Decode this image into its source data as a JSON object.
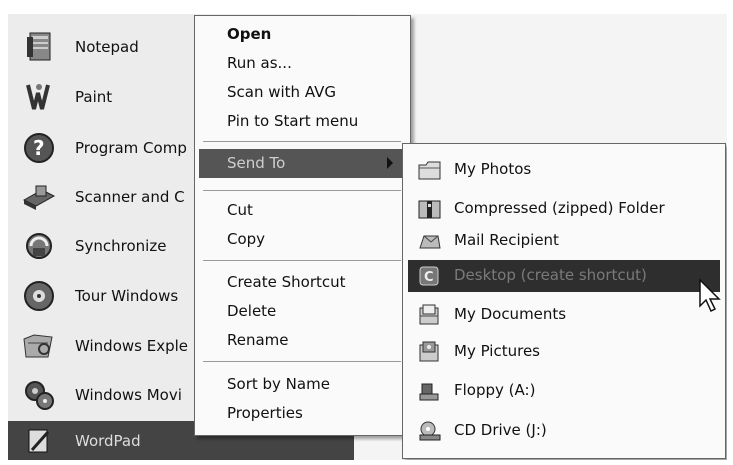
{
  "programs": [
    {
      "label": "Notepad",
      "icon": "notepad-icon"
    },
    {
      "label": "Paint",
      "icon": "paint-icon"
    },
    {
      "label": "Program Comp",
      "icon": "program-compatibility-icon"
    },
    {
      "label": "Scanner and C",
      "icon": "scanner-icon"
    },
    {
      "label": "Synchronize",
      "icon": "synchronize-icon"
    },
    {
      "label": "Tour Windows",
      "icon": "tour-windows-icon"
    },
    {
      "label": "Windows Exple",
      "icon": "windows-explorer-icon"
    },
    {
      "label": "Windows Movi",
      "icon": "windows-movie-maker-icon"
    },
    {
      "label": "WordPad",
      "icon": "wordpad-icon"
    }
  ],
  "context_menu": {
    "open": "Open",
    "run_as": "Run as...",
    "scan": "Scan with AVG",
    "pin": "Pin to Start menu",
    "send_to": "Send To",
    "cut": "Cut",
    "copy": "Copy",
    "create_shortcut": "Create Shortcut",
    "delete": "Delete",
    "rename": "Rename",
    "sort_by_name": "Sort by Name",
    "properties": "Properties"
  },
  "send_to_menu": [
    {
      "label": "My Photos",
      "icon": "folder-icon"
    },
    {
      "label": "Compressed (zipped) Folder",
      "icon": "zip-folder-icon"
    },
    {
      "label": "Mail Recipient",
      "icon": "mail-icon"
    },
    {
      "label": "Desktop (create shortcut)",
      "icon": "desktop-icon"
    },
    {
      "label": "My Documents",
      "icon": "documents-icon"
    },
    {
      "label": "My Pictures",
      "icon": "pictures-icon"
    },
    {
      "label": "Floppy (A:)",
      "icon": "floppy-icon"
    },
    {
      "label": "CD Drive (J:)",
      "icon": "cd-drive-icon"
    }
  ],
  "colors": {
    "highlight": "#444444",
    "menu_bg": "#fafafa",
    "list_bg": "#ececec"
  }
}
